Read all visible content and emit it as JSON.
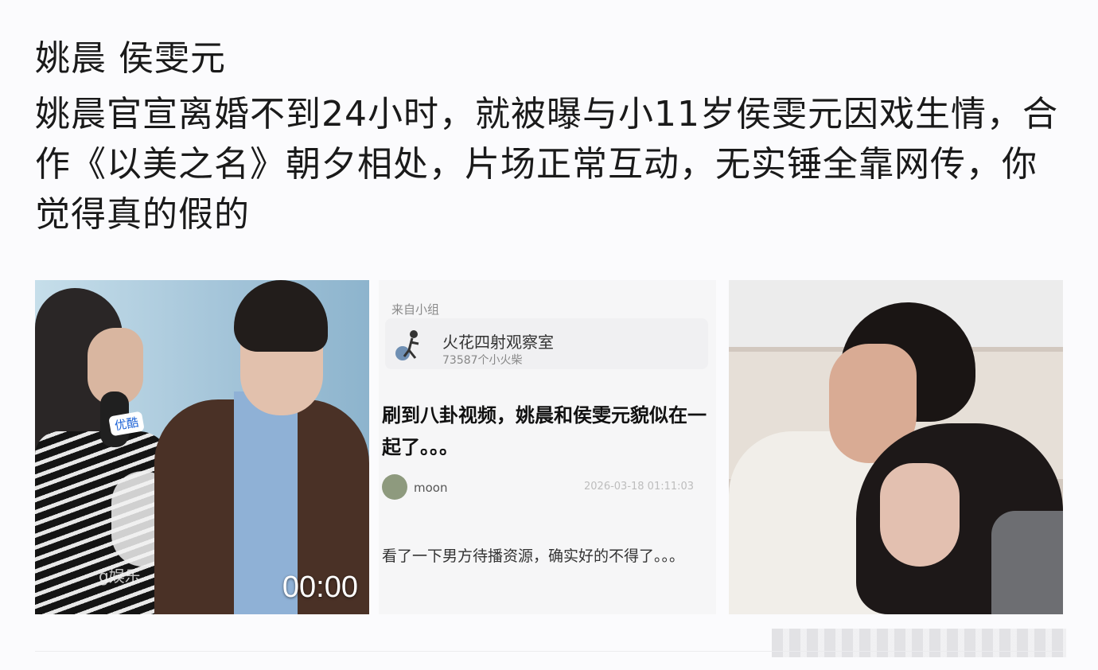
{
  "post": {
    "tags": "姚晨 侯雯元",
    "body": "姚晨官宣离婚不到24小时，就被曝与小11岁侯雯元因戏生情，合作《以美之名》朝夕相处，片场正常互动，无实锤全靠网传，你觉得真的假的"
  },
  "media": [
    {
      "type": "video",
      "watermark": "g娱乐",
      "mic_logo": "优酷",
      "duration": "00:00"
    },
    {
      "type": "screenshot",
      "from_label": "来自小组",
      "group_name": "火花四射观察室",
      "group_count": "73587个小火柴",
      "headline": "刷到八卦视频，姚晨和侯雯元貌似在一起了。。。",
      "username": "moon",
      "timestamp": "2026-03-18 01:11:03",
      "reply": "看了一下男方待播资源，确实好的不得了。。。"
    },
    {
      "type": "image"
    }
  ]
}
